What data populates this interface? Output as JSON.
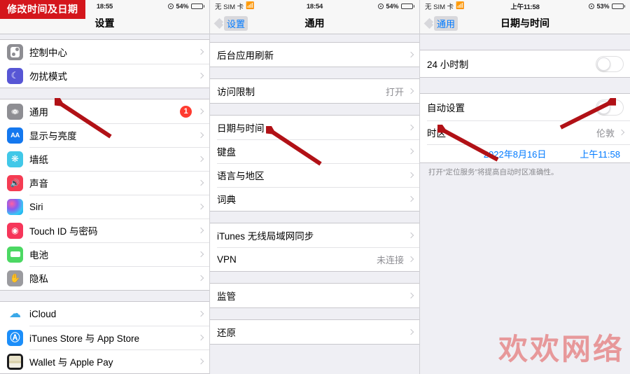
{
  "banner": {
    "text": "修改时间及日期"
  },
  "watermark": {
    "text": "欢欢网络"
  },
  "screen1": {
    "status": {
      "time": "18:55",
      "battery_pct": "54%",
      "location_icon": "location-arrow-icon",
      "battery_icon": "battery-icon"
    },
    "nav": {
      "title": "设置"
    },
    "groups": [
      {
        "rows": [
          {
            "icon": "control-center-icon",
            "label": "控制中心",
            "accessory": "chevron"
          },
          {
            "icon": "moon-icon",
            "label": "勿扰模式",
            "accessory": "chevron"
          }
        ]
      },
      {
        "rows": [
          {
            "icon": "gear-icon",
            "label": "通用",
            "badge": "1",
            "accessory": "chevron"
          },
          {
            "icon": "display-brightness-icon",
            "label": "显示与亮度",
            "accessory": "chevron"
          },
          {
            "icon": "wallpaper-icon",
            "label": "墙纸",
            "accessory": "chevron"
          },
          {
            "icon": "speaker-icon",
            "label": "声音",
            "accessory": "chevron"
          },
          {
            "icon": "siri-icon",
            "label": "Siri",
            "accessory": "chevron"
          },
          {
            "icon": "fingerprint-icon",
            "label": "Touch ID 与密码",
            "accessory": "chevron"
          },
          {
            "icon": "battery-icon",
            "label": "电池",
            "accessory": "chevron"
          },
          {
            "icon": "hand-icon",
            "label": "隐私",
            "accessory": "chevron"
          }
        ]
      },
      {
        "rows": [
          {
            "icon": "cloud-icon",
            "label": "iCloud",
            "accessory": "chevron"
          },
          {
            "icon": "app-store-icon",
            "label": "iTunes Store 与 App Store",
            "accessory": "chevron"
          },
          {
            "icon": "wallet-icon",
            "label": "Wallet 与 Apple Pay",
            "accessory": "chevron"
          }
        ]
      }
    ]
  },
  "screen2": {
    "status": {
      "carrier": "无 SIM 卡",
      "wifi_icon": "wifi-icon",
      "time": "18:54",
      "battery_pct": "54%",
      "location_icon": "location-arrow-icon",
      "battery_icon": "battery-icon"
    },
    "nav": {
      "back_label": "设置",
      "title": "通用"
    },
    "groups": [
      {
        "rows": [
          {
            "label": "后台应用刷新",
            "accessory": "chevron"
          }
        ]
      },
      {
        "rows": [
          {
            "label": "访问限制",
            "value": "打开",
            "accessory": "chevron"
          }
        ]
      },
      {
        "rows": [
          {
            "label": "日期与时间",
            "accessory": "chevron"
          },
          {
            "label": "键盘",
            "accessory": "chevron"
          },
          {
            "label": "语言与地区",
            "accessory": "chevron"
          },
          {
            "label": "词典",
            "accessory": "chevron"
          }
        ]
      },
      {
        "rows": [
          {
            "label": "iTunes 无线局域网同步",
            "accessory": "chevron"
          },
          {
            "label": "VPN",
            "value": "未连接",
            "accessory": "chevron"
          }
        ]
      },
      {
        "rows": [
          {
            "label": "监管",
            "accessory": "chevron"
          }
        ]
      },
      {
        "rows": [
          {
            "label": "还原",
            "accessory": "chevron"
          }
        ]
      }
    ]
  },
  "screen3": {
    "status": {
      "carrier": "无 SIM 卡",
      "wifi_icon": "wifi-icon",
      "time": "上午11:58",
      "battery_pct": "53%",
      "location_icon": "location-arrow-icon",
      "battery_icon": "battery-icon"
    },
    "nav": {
      "back_label": "通用",
      "title": "日期与时间"
    },
    "rows": {
      "hour24": {
        "label": "24 小时制",
        "toggle": "off"
      },
      "auto": {
        "label": "自动设置",
        "toggle": "off"
      },
      "timezone": {
        "label": "时区",
        "value": "伦敦",
        "accessory": "chevron"
      },
      "datetime": {
        "date": "2022年8月16日",
        "time": "上午11:58"
      }
    },
    "footnote": "打开“定位服务”将提高自动时区准确性。"
  }
}
